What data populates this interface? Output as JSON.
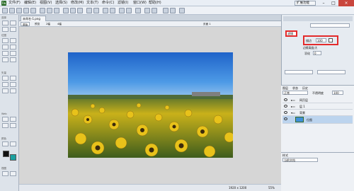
{
  "title_bar": {
    "menus": [
      "文件(F)",
      "编辑(E)",
      "视图(V)",
      "选择(S)",
      "修改(M)",
      "文本(T)",
      "命令(C)",
      "滤镜(I)",
      "窗口(W)",
      "帮助(H)"
    ],
    "workspace": "扩展功能"
  },
  "tools_panel": {
    "sections": [
      "选择",
      "位图",
      "矢量",
      "Web",
      "颜色",
      "视图"
    ]
  },
  "document": {
    "tab_label": "未命名-1.png",
    "view_buttons": [
      "原始",
      "预览",
      "2幅",
      "4幅"
    ],
    "page_label": "页面 1"
  },
  "status_bar": {
    "dimensions": "1920 x 1200",
    "zoom": "55%"
  },
  "properties": {
    "label_box": "滤镜",
    "opacity_label": "描边",
    "opacity_value": "100",
    "sub_label": "边缘高度/大",
    "field2_label": "羽化",
    "field2_value": "0"
  },
  "layers_panel": {
    "tabs": [
      "图层",
      "状态",
      "历史"
    ],
    "blend_mode": "正常",
    "opacity_label": "不透明度",
    "opacity_value": "100",
    "rows": [
      {
        "name": "网页层"
      },
      {
        "name": "层 1"
      },
      {
        "name": "背景"
      },
      {
        "name": "位图"
      }
    ]
  },
  "history_panel": {
    "tab": "样式",
    "dropdown": "当前文档"
  },
  "colors": {
    "accent_red": "#e32b2b",
    "sky": "#3a8fe0",
    "field": "#3f6a1c"
  }
}
